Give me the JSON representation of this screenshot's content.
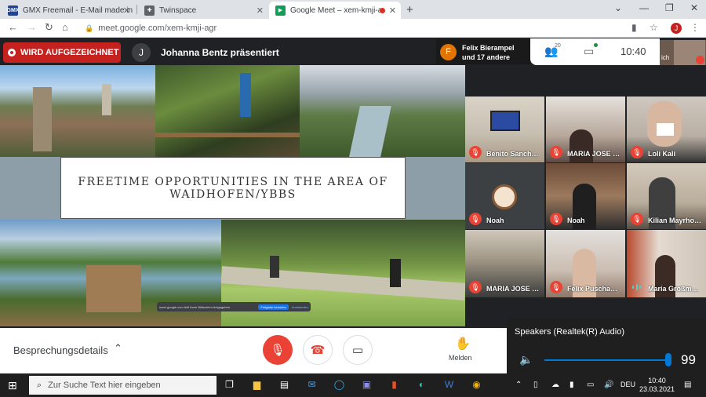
{
  "browser": {
    "tabs": [
      {
        "title": "GMX Freemail - E-Mail made in G",
        "icon": "gmx-icon"
      },
      {
        "title": "Twinspace",
        "icon": "twinspace-icon"
      },
      {
        "title": "Google Meet – xem-kmji-agr",
        "icon": "google-meet-icon"
      }
    ],
    "url": "meet.google.com/xem-kmji-agr",
    "profile_initial": "J"
  },
  "meet": {
    "recording_label": "WIRD AUFGEZEICHNET",
    "presenter_initial": "J",
    "presenter_text": "Johanna Bentz präsentiert",
    "people_initial": "F",
    "people_line1": "Felix Bierampel",
    "people_line2": "und 17 andere",
    "participant_count": "20",
    "time": "10:40",
    "self_label": "ich",
    "slide_title": "FREETIME OPPORTUNITIES IN THE AREA OF WAIDHOFEN/YBBS",
    "share_bar": {
      "text": "meet.google.com teilt Ihren Bildschirm freigegeben.",
      "stop_label": "Freigabe beenden",
      "hide_label": "Ausblenden"
    },
    "tiles": [
      {
        "name": "Benito Sanch…",
        "muted": true
      },
      {
        "name": "MARIA JOSE …",
        "muted": true
      },
      {
        "name": "Loli Kali",
        "muted": true
      },
      {
        "name": "Noah",
        "muted": true
      },
      {
        "name": "Noah",
        "muted": true
      },
      {
        "name": "Kilian Mayrho…",
        "muted": true
      },
      {
        "name": "MARIA JOSE …",
        "muted": true
      },
      {
        "name": "Felix Puscha…",
        "muted": true
      },
      {
        "name": "Maria Großm…",
        "muted": false
      }
    ],
    "details_label": "Besprechungsdetails",
    "raise_label": "Melden"
  },
  "speakers": {
    "title": "Speakers (Realtek(R) Audio)",
    "volume": 99
  },
  "taskbar": {
    "search_placeholder": "Zur Suche Text hier eingeben",
    "language": "DEU",
    "time": "10:40",
    "date": "23.03.2021"
  },
  "colors": {
    "record_red": "#c5221f",
    "meet_bg": "#202124",
    "mute_red": "#ea4335",
    "accent_blue": "#0078d4"
  }
}
